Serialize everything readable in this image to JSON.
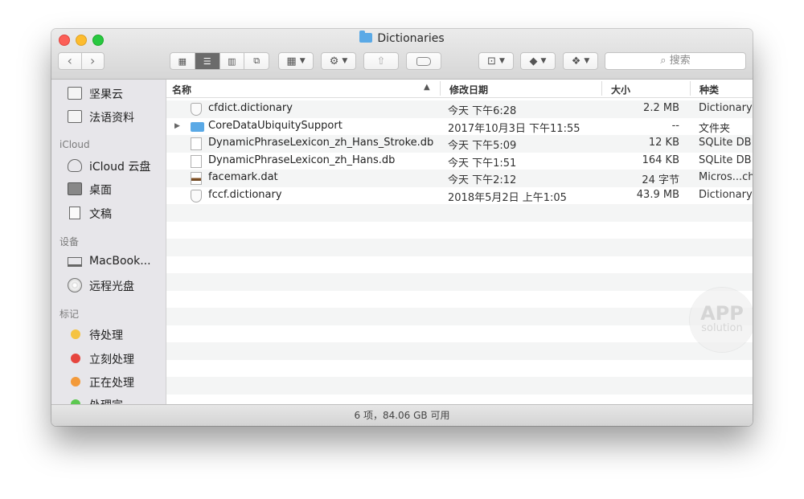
{
  "window": {
    "title": "Dictionaries"
  },
  "toolbar": {
    "back": "‹",
    "forward": "›",
    "views": [
      "▦",
      "☰",
      "▥",
      "⧉"
    ],
    "search_placeholder": "搜索"
  },
  "sidebar": {
    "favorites": [
      {
        "label": "坚果云",
        "icon": "folder-icon"
      },
      {
        "label": "法语资料",
        "icon": "folder-icon"
      }
    ],
    "icloud_header": "iCloud",
    "icloud": [
      {
        "label": "iCloud 云盘",
        "icon": "cloud-icon"
      },
      {
        "label": "桌面",
        "icon": "desktop-icon"
      },
      {
        "label": "文稿",
        "icon": "document-icon"
      }
    ],
    "devices_header": "设备",
    "devices": [
      {
        "label": "MacBook...",
        "icon": "laptop-icon"
      },
      {
        "label": "远程光盘",
        "icon": "disc-icon"
      }
    ],
    "tags_header": "标记",
    "tags": [
      {
        "label": "待处理",
        "color": "#f5c342"
      },
      {
        "label": "立刻处理",
        "color": "#e6453e"
      },
      {
        "label": "正在处理",
        "color": "#f39a3a"
      },
      {
        "label": "处理完",
        "color": "#5cc850"
      }
    ]
  },
  "columns": {
    "name": "名称",
    "date": "修改日期",
    "size": "大小",
    "kind": "种类"
  },
  "files": [
    {
      "name": "cfdict.dictionary",
      "date": "今天 下午6:28",
      "size": "2.2 MB",
      "kind": "Dictionary",
      "icon": "dictionary-icon"
    },
    {
      "name": "CoreDataUbiquitySupport",
      "date": "2017年10月3日 下午11:55",
      "size": "--",
      "kind": "文件夹",
      "icon": "folder-icon"
    },
    {
      "name": "DynamicPhraseLexicon_zh_Hans_Stroke.db",
      "date": "今天 下午5:09",
      "size": "12 KB",
      "kind": "SQLite DB",
      "icon": "file-icon"
    },
    {
      "name": "DynamicPhraseLexicon_zh_Hans.db",
      "date": "今天 下午1:51",
      "size": "164 KB",
      "kind": "SQLite DB",
      "icon": "file-icon"
    },
    {
      "name": "facemark.dat",
      "date": "今天 下午2:12",
      "size": "24 字节",
      "kind": "Micros...ch",
      "icon": "dat-file-icon"
    },
    {
      "name": "fccf.dictionary",
      "date": "2018年5月2日 上午1:05",
      "size": "43.9 MB",
      "kind": "Dictionary",
      "icon": "dictionary-icon"
    }
  ],
  "watermark": {
    "line1": "APP",
    "line2": "solution"
  },
  "status": "6 项，84.06 GB 可用"
}
